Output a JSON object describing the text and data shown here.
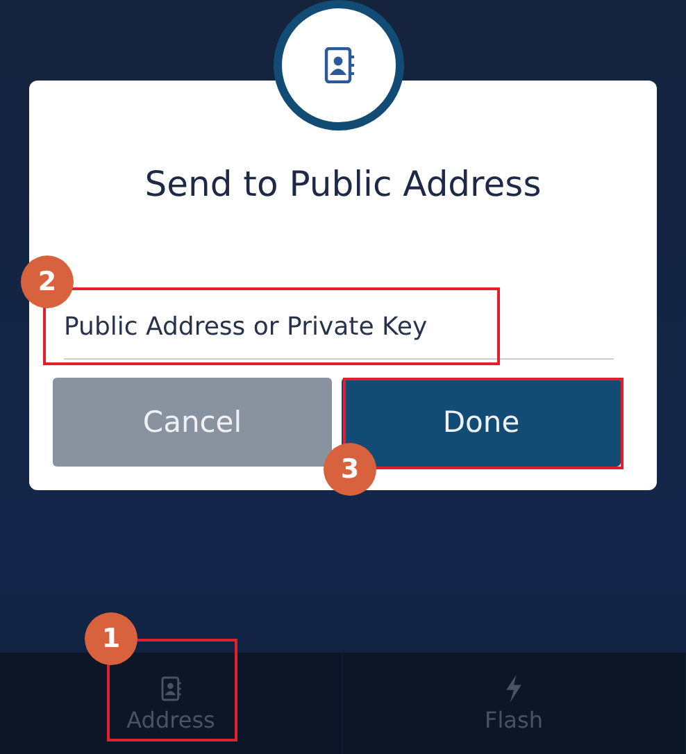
{
  "dialog": {
    "title": "Send to Public Address",
    "field": {
      "placeholder": "Public Address or Private Key"
    },
    "buttons": [
      {
        "label": "Cancel",
        "kind": "secondary"
      },
      {
        "label": "Done",
        "kind": "primary"
      }
    ]
  },
  "tab_bar": {
    "tabs": [
      {
        "label": "Address"
      },
      {
        "label": "Flash"
      }
    ]
  },
  "annotations": [
    {
      "number": "1"
    },
    {
      "number": "2"
    },
    {
      "number": "3"
    }
  ]
}
